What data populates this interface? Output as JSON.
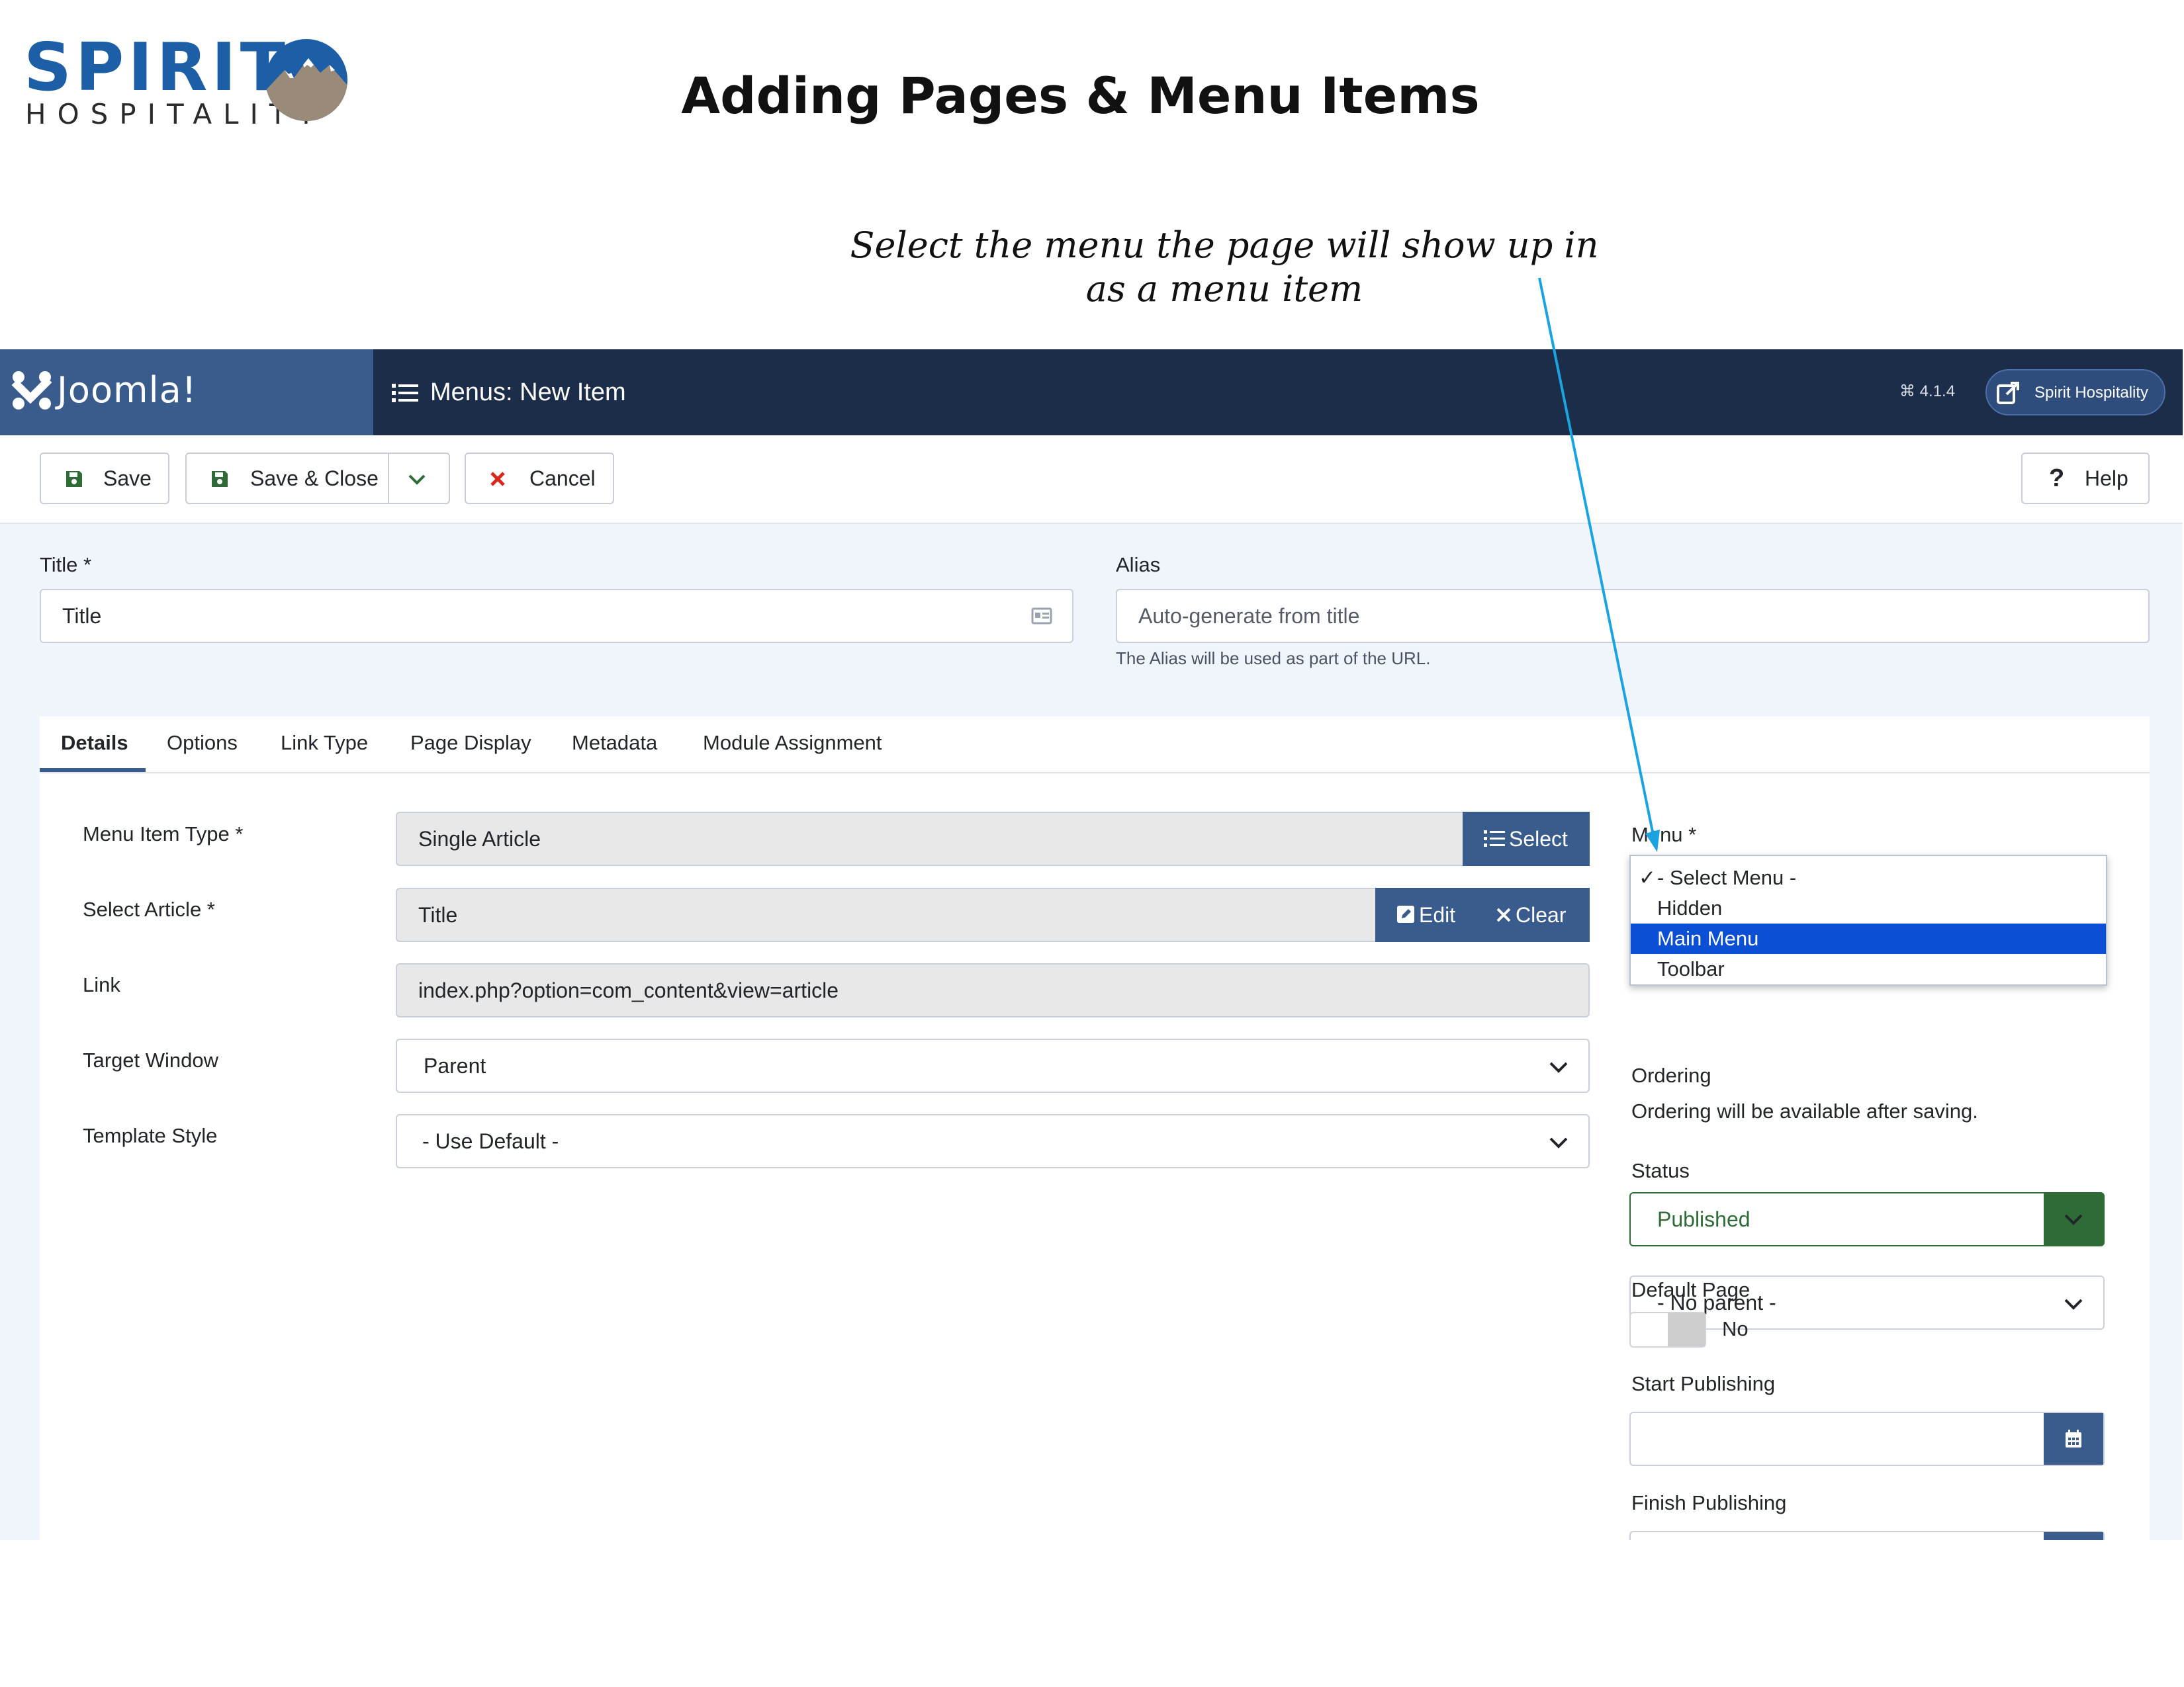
{
  "document": {
    "logo_word": "SPIRIT",
    "logo_sub": "HOSPITALITY",
    "title": "Adding Pages & Menu Items",
    "annotation": "Select the menu the page will show up in as a menu item"
  },
  "topbar": {
    "brand": "Joomla!",
    "heading": "Menus: New Item",
    "version": "4.1.4",
    "site_link": "Spirit Hospitality"
  },
  "toolbar": {
    "save": "Save",
    "save_close": "Save & Close",
    "cancel": "Cancel",
    "help": "Help"
  },
  "form": {
    "title_label": "Title *",
    "title_value": "Title",
    "alias_label": "Alias",
    "alias_placeholder": "Auto-generate from title",
    "alias_help": "The Alias will be used as part of the URL."
  },
  "tabs": [
    "Details",
    "Options",
    "Link Type",
    "Page Display",
    "Metadata",
    "Module Assignment"
  ],
  "details": {
    "menu_item_type_label": "Menu Item Type *",
    "menu_item_type_value": "Single Article",
    "select_btn": "Select",
    "select_article_label": "Select Article *",
    "select_article_value": "Title",
    "edit_btn": "Edit",
    "clear_btn": "Clear",
    "link_label": "Link",
    "link_value": "index.php?option=com_content&view=article",
    "target_window_label": "Target Window",
    "target_window_value": "Parent",
    "template_style_label": "Template Style",
    "template_style_value": "- Use Default -"
  },
  "sidebar": {
    "menu_label": "Menu *",
    "menu_options": [
      "- Select Menu -",
      "Hidden",
      "Main Menu",
      "Toolbar"
    ],
    "menu_checked": "- Select Menu -",
    "menu_highlighted": "Main Menu",
    "parent_value": "- No parent -",
    "ordering_label": "Ordering",
    "ordering_text": "Ordering will be available after saving.",
    "status_label": "Status",
    "status_value": "Published",
    "default_page_label": "Default Page",
    "default_page_value": "No",
    "start_publishing_label": "Start Publishing",
    "finish_publishing_label": "Finish Publishing"
  },
  "colors": {
    "topbar": "#1c2d4a",
    "brand_bg": "#3a5c8d",
    "accent_blue": "#3a5c8d",
    "highlight": "#0a4fd6",
    "status_green": "#2f6b36",
    "arrow": "#1aa3e0"
  }
}
